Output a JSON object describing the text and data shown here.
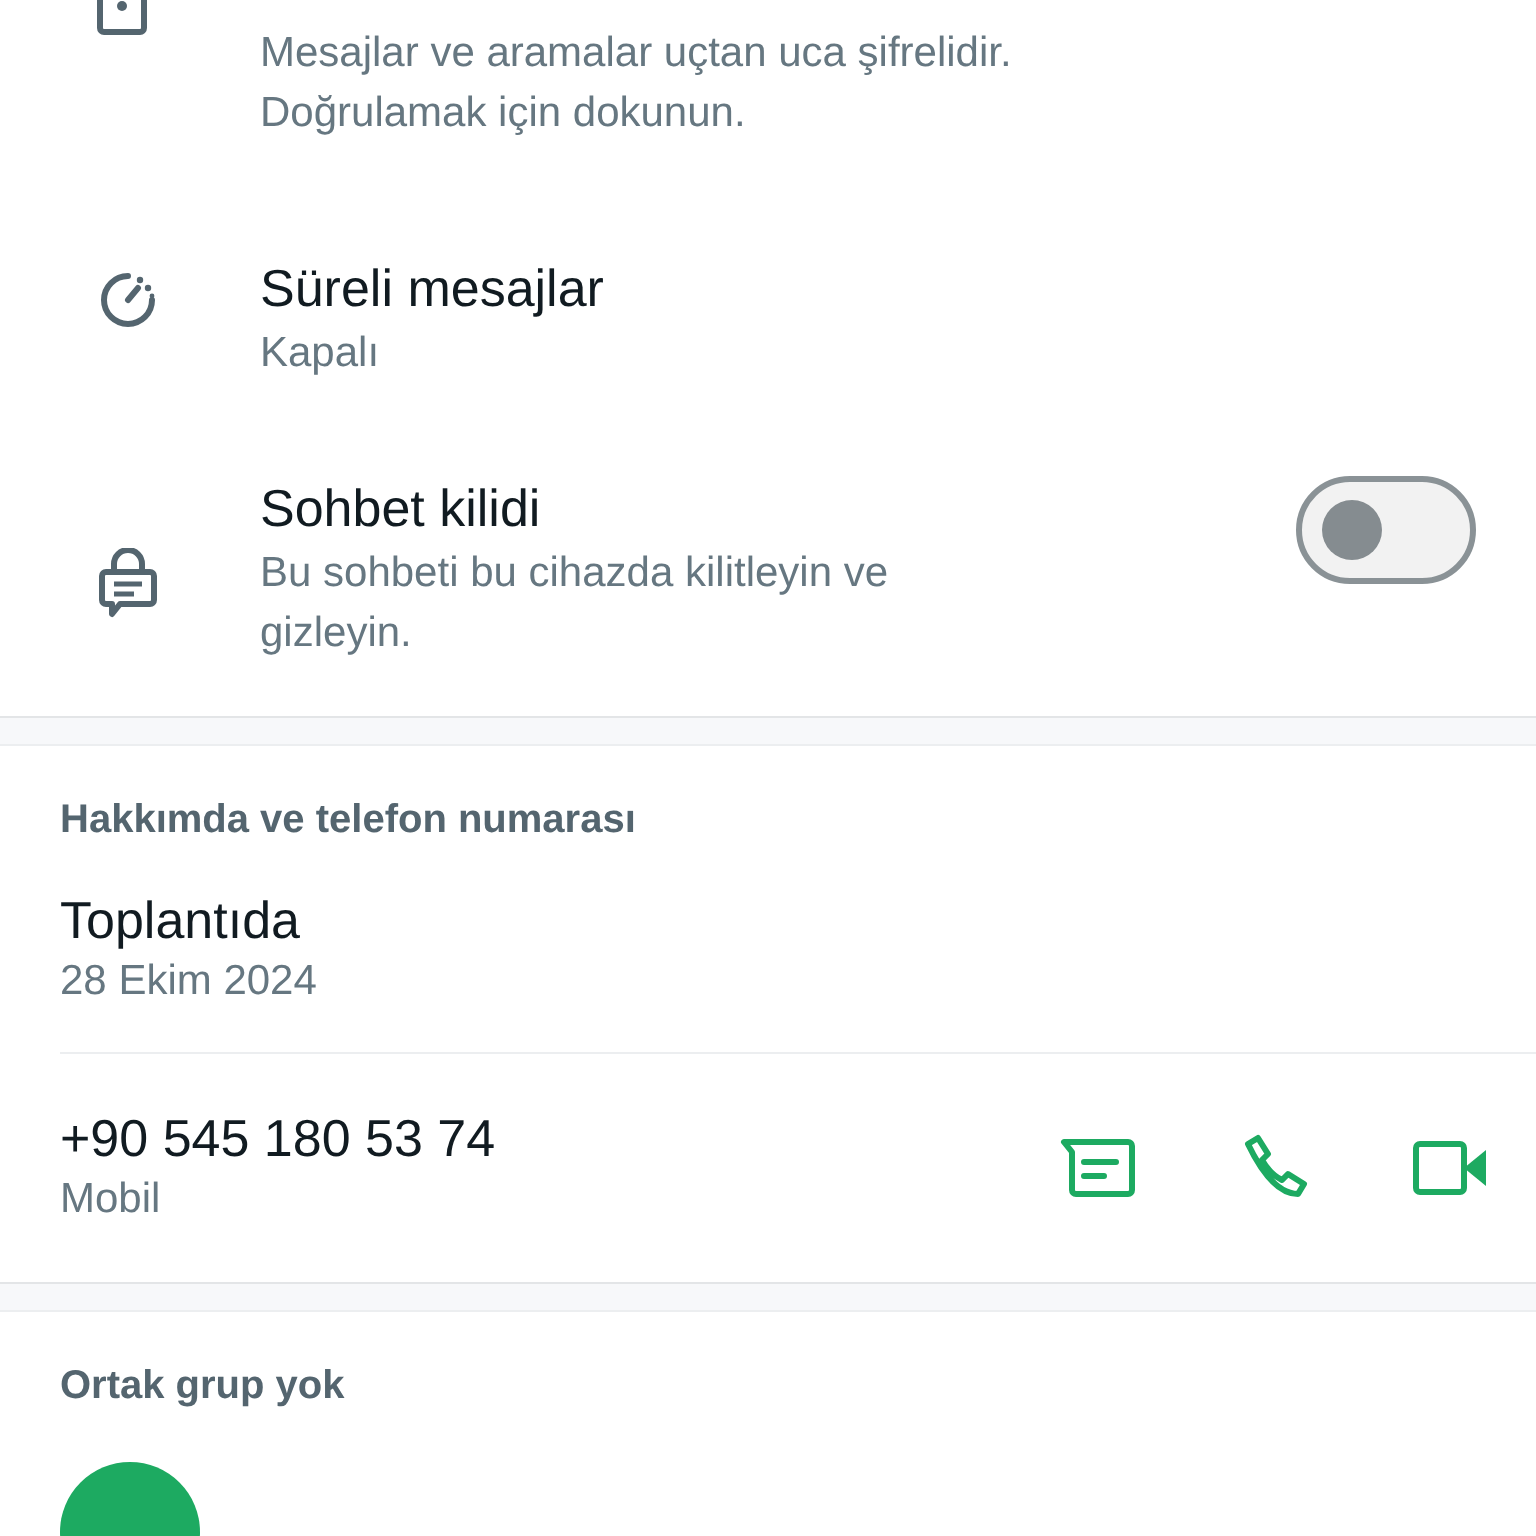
{
  "security_items": [
    {
      "kind": "encryption",
      "subtitle": "Mesajlar ve aramalar uçtan uca şifrelidir. Doğrulamak için dokunun."
    },
    {
      "kind": "timer",
      "title": "Süreli mesajlar",
      "subtitle": "Kapalı"
    },
    {
      "kind": "chat_lock",
      "title": "Sohbet kilidi",
      "subtitle": "Bu sohbeti bu cihazda kilitleyin ve gizleyin.",
      "toggle": {
        "on": false
      }
    }
  ],
  "about": {
    "header": "Hakkımda ve telefon numarası",
    "status": "Toplantıda",
    "status_date": "28 Ekim 2024",
    "phone": "+90 545 180 53 74",
    "phone_type": "Mobil"
  },
  "groups": {
    "header": "Ortak grup yok"
  }
}
